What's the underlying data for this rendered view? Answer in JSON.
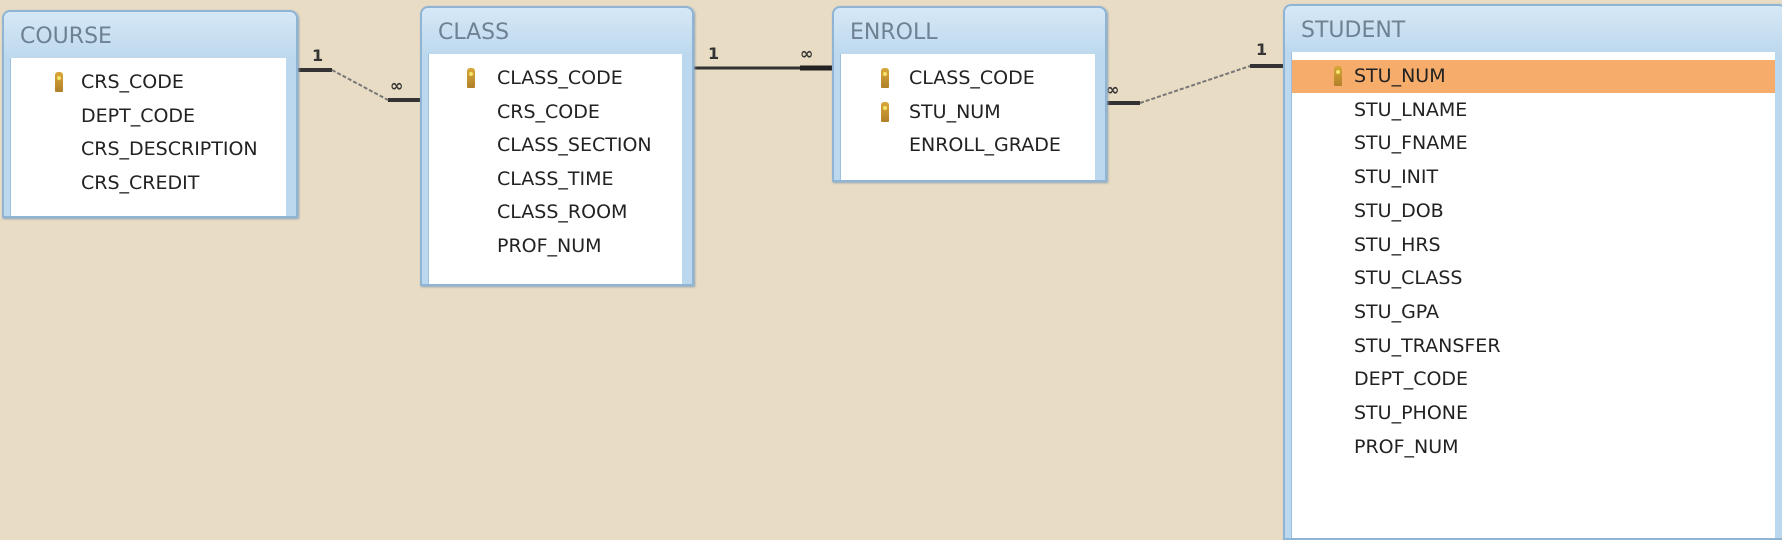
{
  "tables": {
    "course": {
      "title": "COURSE",
      "fields": [
        {
          "name": "CRS_CODE",
          "key": true
        },
        {
          "name": "DEPT_CODE"
        },
        {
          "name": "CRS_DESCRIPTION"
        },
        {
          "name": "CRS_CREDIT"
        }
      ]
    },
    "class": {
      "title": "CLASS",
      "fields": [
        {
          "name": "CLASS_CODE",
          "key": true
        },
        {
          "name": "CRS_CODE"
        },
        {
          "name": "CLASS_SECTION"
        },
        {
          "name": "CLASS_TIME"
        },
        {
          "name": "CLASS_ROOM"
        },
        {
          "name": "PROF_NUM"
        }
      ]
    },
    "enroll": {
      "title": "ENROLL",
      "fields": [
        {
          "name": "CLASS_CODE",
          "key": true
        },
        {
          "name": "STU_NUM",
          "key": true
        },
        {
          "name": "ENROLL_GRADE"
        }
      ]
    },
    "student": {
      "title": "STUDENT",
      "fields": [
        {
          "name": "STU_NUM",
          "key": true,
          "selected": true
        },
        {
          "name": "STU_LNAME"
        },
        {
          "name": "STU_FNAME"
        },
        {
          "name": "STU_INIT"
        },
        {
          "name": "STU_DOB"
        },
        {
          "name": "STU_HRS"
        },
        {
          "name": "STU_CLASS"
        },
        {
          "name": "STU_GPA"
        },
        {
          "name": "STU_TRANSFER"
        },
        {
          "name": "DEPT_CODE"
        },
        {
          "name": "STU_PHONE"
        },
        {
          "name": "PROF_NUM"
        }
      ]
    }
  },
  "relationships": [
    {
      "from": "COURSE.CRS_CODE",
      "to": "CLASS.CRS_CODE",
      "one_label": "1",
      "many_label": "∞"
    },
    {
      "from": "CLASS.CLASS_CODE",
      "to": "ENROLL.CLASS_CODE",
      "one_label": "1",
      "many_label": "∞"
    },
    {
      "from": "STUDENT.STU_NUM",
      "to": "ENROLL.STU_NUM",
      "one_label": "1",
      "many_label": "∞"
    }
  ],
  "colors": {
    "background": "#e8dcc4",
    "selected_row": "#f6ad6c",
    "title_bar": "#bcd8ee"
  }
}
